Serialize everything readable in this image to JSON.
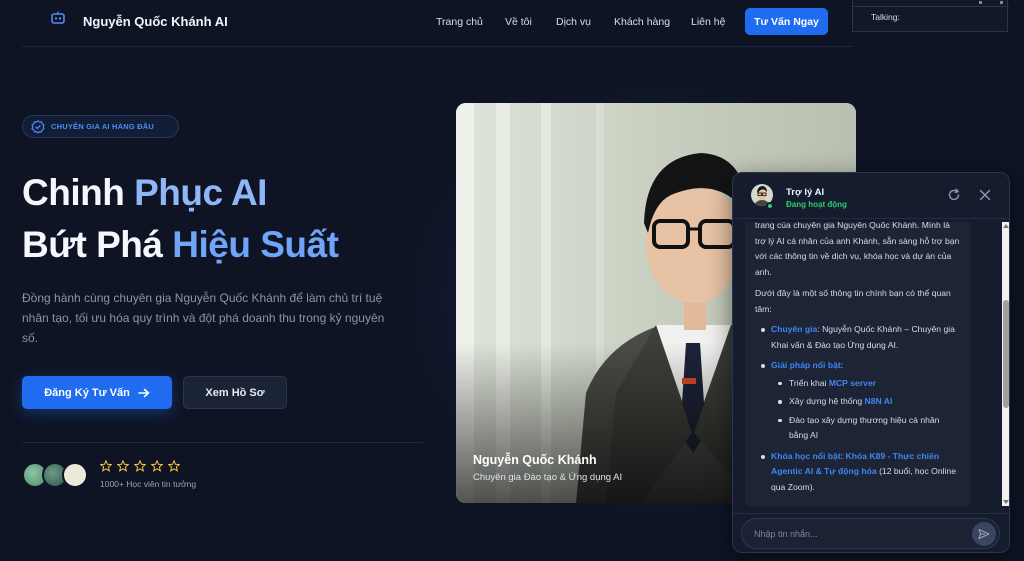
{
  "nav": {
    "brand": "Nguyễn Quốc Khánh AI",
    "logo_icon": "robot-icon",
    "links": [
      "Trang chủ",
      "Về tôi",
      "Dịch vụ",
      "Khách hàng",
      "Liên hệ"
    ],
    "cta": "Tư Vấn Ngay"
  },
  "talking_widget": {
    "label": "Talking:"
  },
  "hero": {
    "badge": "CHUYÊN GIA AI HÀNG ĐẦU",
    "headline_1a": "Chinh ",
    "headline_1b": "Phục AI",
    "headline_2a": "Bứt Phá ",
    "headline_2b": "Hiệu Suất",
    "description": "Đồng hành cùng chuyên gia Nguyễn Quốc Khánh để làm chủ trí tuệ nhân tạo, tối ưu hóa quy trình và đột phá doanh thu trong kỷ nguyên số.",
    "primary_button": "Đăng Ký Tư Vấn",
    "secondary_button": "Xem Hồ Sơ",
    "rating_stars": 5,
    "social_proof": "1000+ Học viên tin tưởng"
  },
  "photo": {
    "name": "Nguyễn Quốc Khánh",
    "role": "Chuyên gia Đào tạo & Ứng dụng AI"
  },
  "chat": {
    "title": "Trợ lý AI",
    "status": "Đang hoạt động",
    "intro": "trang của chuyên gia Nguyễn Quốc Khánh. Mình là trợ lý AI cá nhân của anh Khánh, sẵn sàng hỗ trợ bạn với các thông tin về dịch vụ, khóa học và dự án của anh.",
    "lead": "Dưới đây là một số thông tin chính bạn có thể quan tâm:",
    "item1_label": "Chuyên gia",
    "item1_text": ": Nguyễn Quốc Khánh – Chuyên gia Khai vấn & Đào tạo Ứng dụng AI.",
    "item2_label": "Giải pháp nổi bật",
    "item2_colon": ":",
    "sub1_text": "Triển khai ",
    "sub1_link": "MCP server",
    "sub2_text": "Xây dựng hệ thống ",
    "sub2_link": "N8N AI",
    "sub3_text": "Đào tạo xây dựng thương hiệu cá nhân bằng AI",
    "item3_label": "Khóa học nổi bật",
    "item3_colon": ": ",
    "item3_link": "Khóa K89 - Thực chiến Agentic AI & Tự động hóa",
    "item3_text": " (12 buổi, học Online qua Zoom).",
    "input_placeholder": "Nhập tin nhắn..."
  },
  "colors": {
    "background": "#0e1424",
    "accent": "#1f6cf0",
    "highlight": "#8fb6f7",
    "online": "#2ecc71"
  }
}
